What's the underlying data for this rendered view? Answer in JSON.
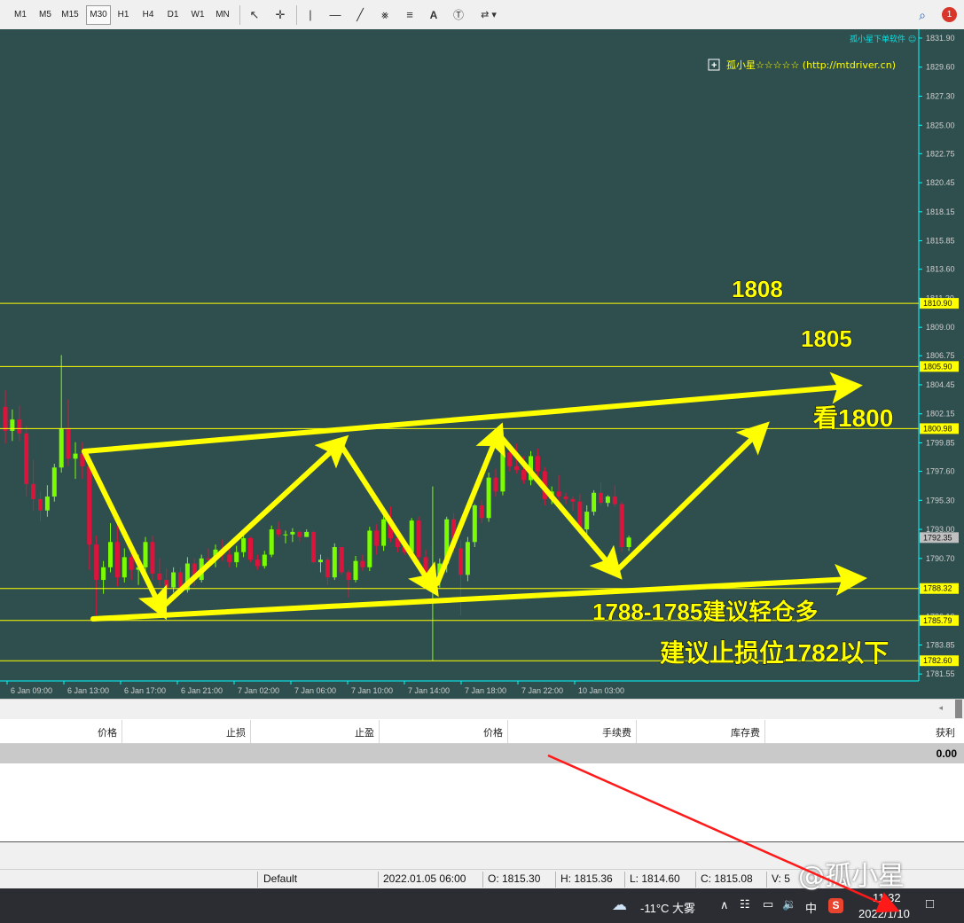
{
  "toolbar": {
    "timeframes": [
      "M1",
      "M5",
      "M15",
      "M30",
      "H1",
      "H4",
      "D1",
      "W1",
      "MN"
    ],
    "active_timeframe": "M30",
    "notification_count": "1"
  },
  "chart": {
    "background": "#2f4f4f",
    "up_color": "#7cfc00",
    "down_color": "#dc143c",
    "axis_color": "#00ffff",
    "watermark": "孤小星下单软件",
    "indicator_label": "孤小星☆☆☆☆☆ (http://mtdriver.cn)",
    "annotations": {
      "a1808": "1808",
      "a1805": "1805",
      "a1800": "看1800",
      "buy_zone": "1788-1785建议轻仓多",
      "stop_loss": "建议止损位1782以下"
    }
  },
  "chart_data": {
    "type": "candlestick",
    "y_ticks": [
      1831.9,
      1829.6,
      1827.3,
      1825.0,
      1822.75,
      1820.45,
      1818.15,
      1815.85,
      1813.6,
      1811.3,
      1809.0,
      1806.75,
      1804.45,
      1802.15,
      1799.85,
      1797.6,
      1795.3,
      1793.0,
      1790.7,
      1788.4,
      1786.1,
      1783.85,
      1781.55
    ],
    "ylim": [
      1781.0,
      1832.6
    ],
    "x_ticks": [
      "6 Jan 09:00",
      "6 Jan 13:00",
      "6 Jan 17:00",
      "6 Jan 21:00",
      "7 Jan 02:00",
      "7 Jan 06:00",
      "7 Jan 10:00",
      "7 Jan 14:00",
      "7 Jan 18:00",
      "7 Jan 22:00",
      "10 Jan 03:00"
    ],
    "horizontal_lines": [
      {
        "value": 1810.9,
        "label": "1810.90"
      },
      {
        "value": 1805.9,
        "label": "1805.90"
      },
      {
        "value": 1800.98,
        "label": "1800.98"
      },
      {
        "value": 1788.32,
        "label": "1788.32"
      },
      {
        "value": 1785.79,
        "label": "1785.79"
      },
      {
        "value": 1782.6,
        "label": "1782.60"
      }
    ],
    "current_price": 1792.35,
    "candles": [
      [
        1802.7,
        1804.0,
        1799.8,
        1800.8
      ],
      [
        1800.8,
        1802.5,
        1800.0,
        1801.7
      ],
      [
        1801.7,
        1802.8,
        1800.0,
        1800.6
      ],
      [
        1800.6,
        1801.2,
        1795.6,
        1796.6
      ],
      [
        1796.6,
        1798.5,
        1794.5,
        1795.4
      ],
      [
        1795.4,
        1796.0,
        1793.6,
        1794.5
      ],
      [
        1794.5,
        1796.5,
        1794.0,
        1795.6
      ],
      [
        1795.6,
        1798.2,
        1795.2,
        1797.9
      ],
      [
        1797.9,
        1806.8,
        1797.5,
        1801.0
      ],
      [
        1801.0,
        1803.3,
        1798.0,
        1798.6
      ],
      [
        1798.6,
        1799.9,
        1797.0,
        1799.0
      ],
      [
        1799.0,
        1799.9,
        1797.0,
        1798.0
      ],
      [
        1798.0,
        1798.7,
        1789.8,
        1791.8
      ],
      [
        1791.8,
        1792.5,
        1786.2,
        1789.0
      ],
      [
        1789.0,
        1790.5,
        1787.9,
        1790.0
      ],
      [
        1790.0,
        1793.5,
        1789.6,
        1792.0
      ],
      [
        1792.0,
        1793.3,
        1788.5,
        1789.2
      ],
      [
        1789.2,
        1791.5,
        1788.8,
        1790.8
      ],
      [
        1790.8,
        1792.0,
        1789.0,
        1789.8
      ],
      [
        1789.8,
        1791.0,
        1788.6,
        1790.0
      ],
      [
        1790.0,
        1792.4,
        1789.5,
        1792.0
      ],
      [
        1792.0,
        1792.5,
        1789.0,
        1789.5
      ],
      [
        1789.5,
        1790.7,
        1788.5,
        1789.0
      ],
      [
        1789.0,
        1789.9,
        1787.8,
        1788.4
      ],
      [
        1788.4,
        1790.0,
        1788.0,
        1789.6
      ],
      [
        1789.6,
        1790.0,
        1787.9,
        1788.2
      ],
      [
        1788.2,
        1790.8,
        1788.0,
        1790.3
      ],
      [
        1790.3,
        1790.7,
        1788.5,
        1789.0
      ],
      [
        1789.0,
        1791.0,
        1788.8,
        1790.7
      ],
      [
        1790.7,
        1791.5,
        1790.0,
        1790.6
      ],
      [
        1790.6,
        1791.8,
        1790.0,
        1791.4
      ],
      [
        1791.4,
        1792.2,
        1790.5,
        1791.0
      ],
      [
        1791.0,
        1791.6,
        1790.0,
        1790.4
      ],
      [
        1790.4,
        1791.7,
        1790.0,
        1791.2
      ],
      [
        1791.2,
        1792.6,
        1790.8,
        1792.3
      ],
      [
        1792.3,
        1792.4,
        1790.4,
        1790.6
      ],
      [
        1790.6,
        1791.0,
        1789.8,
        1790.1
      ],
      [
        1790.1,
        1791.3,
        1789.9,
        1791.0
      ],
      [
        1791.0,
        1793.3,
        1790.8,
        1793.0
      ],
      [
        1793.0,
        1793.6,
        1792.4,
        1792.6
      ],
      [
        1792.6,
        1792.9,
        1791.9,
        1792.6
      ],
      [
        1792.6,
        1793.1,
        1792.0,
        1792.8
      ],
      [
        1792.8,
        1792.9,
        1792.0,
        1792.4
      ],
      [
        1792.4,
        1793.0,
        1792.4,
        1792.8
      ],
      [
        1792.8,
        1792.9,
        1790.3,
        1790.4
      ],
      [
        1790.4,
        1791.0,
        1789.6,
        1790.6
      ],
      [
        1790.6,
        1790.8,
        1788.6,
        1789.2
      ],
      [
        1789.2,
        1791.9,
        1789.0,
        1791.6
      ],
      [
        1791.6,
        1791.6,
        1789.4,
        1789.6
      ],
      [
        1789.6,
        1789.8,
        1787.6,
        1789.0
      ],
      [
        1789.0,
        1790.9,
        1788.8,
        1790.5
      ],
      [
        1790.5,
        1791.0,
        1789.7,
        1790.0
      ],
      [
        1790.0,
        1793.2,
        1789.7,
        1792.9
      ],
      [
        1792.9,
        1793.4,
        1791.0,
        1791.7
      ],
      [
        1791.7,
        1794.6,
        1791.3,
        1793.8
      ],
      [
        1793.8,
        1794.8,
        1792.0,
        1792.3
      ],
      [
        1792.3,
        1792.9,
        1791.2,
        1791.6
      ],
      [
        1791.6,
        1792.2,
        1791.0,
        1791.2
      ],
      [
        1791.2,
        1793.9,
        1791.0,
        1793.7
      ],
      [
        1793.7,
        1794.0,
        1790.4,
        1790.8
      ],
      [
        1790.8,
        1791.4,
        1788.6,
        1789.0
      ],
      [
        1789.0,
        1796.4,
        1782.6,
        1789.4
      ],
      [
        1789.4,
        1790.7,
        1788.4,
        1790.3
      ],
      [
        1790.3,
        1794.0,
        1789.6,
        1793.8
      ],
      [
        1793.8,
        1794.3,
        1791.1,
        1791.5
      ],
      [
        1791.5,
        1792.2,
        1786.2,
        1789.4
      ],
      [
        1789.4,
        1792.4,
        1788.9,
        1792.0
      ],
      [
        1792.0,
        1795.0,
        1791.6,
        1794.9
      ],
      [
        1794.9,
        1795.3,
        1793.5,
        1793.9
      ],
      [
        1793.9,
        1797.5,
        1793.6,
        1797.1
      ],
      [
        1797.1,
        1797.8,
        1795.6,
        1796.0
      ],
      [
        1796.0,
        1799.6,
        1795.7,
        1799.1
      ],
      [
        1799.1,
        1799.5,
        1797.6,
        1798.0
      ],
      [
        1798.0,
        1799.8,
        1797.4,
        1797.7
      ],
      [
        1797.7,
        1798.8,
        1796.6,
        1796.9
      ],
      [
        1796.9,
        1799.2,
        1796.5,
        1798.8
      ],
      [
        1798.8,
        1799.4,
        1797.2,
        1797.6
      ],
      [
        1797.6,
        1797.9,
        1794.9,
        1795.4
      ],
      [
        1795.4,
        1796.4,
        1795.0,
        1796.0
      ],
      [
        1796.0,
        1797.3,
        1795.1,
        1795.6
      ],
      [
        1795.6,
        1795.9,
        1795.0,
        1795.4
      ],
      [
        1795.4,
        1795.6,
        1794.5,
        1795.2
      ],
      [
        1795.2,
        1795.8,
        1792.6,
        1793.0
      ],
      [
        1793.0,
        1794.9,
        1792.6,
        1794.4
      ],
      [
        1794.4,
        1796.1,
        1794.1,
        1795.9
      ],
      [
        1795.9,
        1796.7,
        1794.9,
        1795.1
      ],
      [
        1795.1,
        1795.7,
        1794.8,
        1795.6
      ],
      [
        1795.6,
        1796.5,
        1794.8,
        1795.0
      ],
      [
        1795.0,
        1795.2,
        1791.2,
        1791.6
      ],
      [
        1791.6,
        1792.5,
        1791.3,
        1792.35
      ]
    ]
  },
  "grid": {
    "columns": [
      "价格",
      "止损",
      "止盈",
      "价格",
      "手续费",
      "库存费",
      "获利"
    ],
    "total": "0.00"
  },
  "statusbar": {
    "profile": "Default",
    "datetime": "2022.01.05 06:00",
    "open": "O: 1815.30",
    "high": "H: 1815.36",
    "low": "L: 1814.60",
    "close": "C: 1815.08",
    "volume": "V: 5"
  },
  "taskbar": {
    "weather": "-11°C 大雾",
    "ime": "中",
    "time": "11:32",
    "date": "2022/1/10",
    "watermark": "@孤小星"
  }
}
